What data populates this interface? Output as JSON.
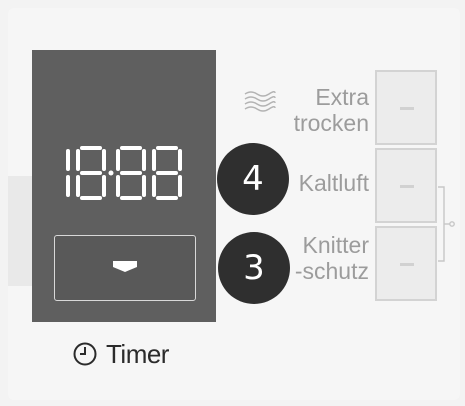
{
  "display": {
    "time": "18:88",
    "down_button": "down-arrow"
  },
  "timer": {
    "icon": "clock-icon",
    "label": "Timer"
  },
  "badges": {
    "four": "4",
    "three": "3"
  },
  "options": {
    "extra_trocken": {
      "line1": "Extra",
      "line2": "trocken",
      "icon": "steam-icon"
    },
    "kaltluft": {
      "label": "Kaltluft"
    },
    "knitterschutz": {
      "line1": "Knitter",
      "line2": "-schutz"
    }
  },
  "colors": {
    "display_bg": "#5f5f5f",
    "badge_bg": "#2f2f2f",
    "label_gray": "#9c9c9c"
  }
}
